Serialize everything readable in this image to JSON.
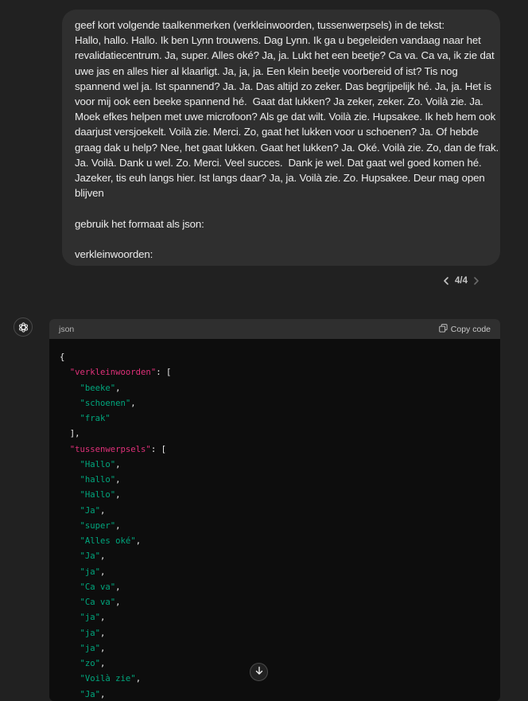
{
  "user_message": {
    "lines": [
      "geef kort volgende taalkenmerken (verkleinwoorden, tussenwerpsels) in de tekst:",
      "Hallo, hallo. Hallo. Ik ben Lynn trouwens. Dag Lynn. Ik ga u begeleiden vandaag naar het",
      "revalidatiecentrum. Ja, super. Alles oké? Ja, ja. Lukt het een beetje? Ca va. Ca va, ik zie dat",
      "uwe jas en alles hier al klaarligt. Ja, ja, ja. Een klein beetje voorbereid of ist? Tis nog",
      "spannend wel ja. Ist spannend? Ja. Ja. Das altijd zo zeker. Das begrijpelijk hé. Ja, ja. Het is",
      "voor mij ook een beeke spannend hé.  Gaat dat lukken? Ja zeker, zeker. Zo. Voilà zie. Ja.",
      "Moek efkes helpen met uwe microfoon? Als ge dat wilt. Voilà zie. Hupsakee. Ik heb hem ook",
      "daarjust versjoekelt. Voilà zie. Merci. Zo, gaat het lukken voor u schoenen? Ja. Of hebde",
      "graag dak u help? Nee, het gaat lukken. Gaat het lukken? Ja. Oké. Voilà zie. Zo, dan de frak.",
      "Ja. Voilà. Dank u wel. Zo. Merci. Veel succes.  Dank je wel. Dat gaat wel goed komen hé.",
      "Jazeker, tis euh langs hier. Ist langs daar? Ja, ja. Voilà zie. Zo. Hupsakee. Deur mag open",
      "blijven"
    ],
    "format_line": "gebruik het formaat als json:",
    "last_line": "verkleinwoorden:"
  },
  "pager": {
    "text": "4/4"
  },
  "code_block": {
    "language": "json",
    "copy_label": "Copy code",
    "open_brace": "{",
    "key1": "\"verkleinwoorden\"",
    "key1_items": [
      "\"beeke\"",
      "\"schoenen\"",
      "\"frak\""
    ],
    "close_array": "],",
    "key2": "\"tussenwerpsels\"",
    "key2_items": [
      "\"Hallo\"",
      "\"hallo\"",
      "\"Hallo\"",
      "\"Ja\"",
      "\"super\"",
      "\"Alles oké\"",
      "\"Ja\"",
      "\"ja\"",
      "\"Ca va\"",
      "\"Ca va\"",
      "\"ja\"",
      "\"ja\"",
      "\"ja\"",
      "\"zo\"",
      "\"Voilà zie\"",
      "\"Ja\""
    ]
  },
  "icons": {
    "avatar": "openai-logo-icon",
    "copy": "copy-icon",
    "scroll": "arrow-down-icon",
    "pager_prev": "chevron-left-icon",
    "pager_next": "chevron-right-icon"
  },
  "colors": {
    "background": "#212121",
    "bubble": "#2f2f2f",
    "code_bg": "#0d0d0d",
    "key": "#df3079",
    "string": "#00a67d"
  }
}
